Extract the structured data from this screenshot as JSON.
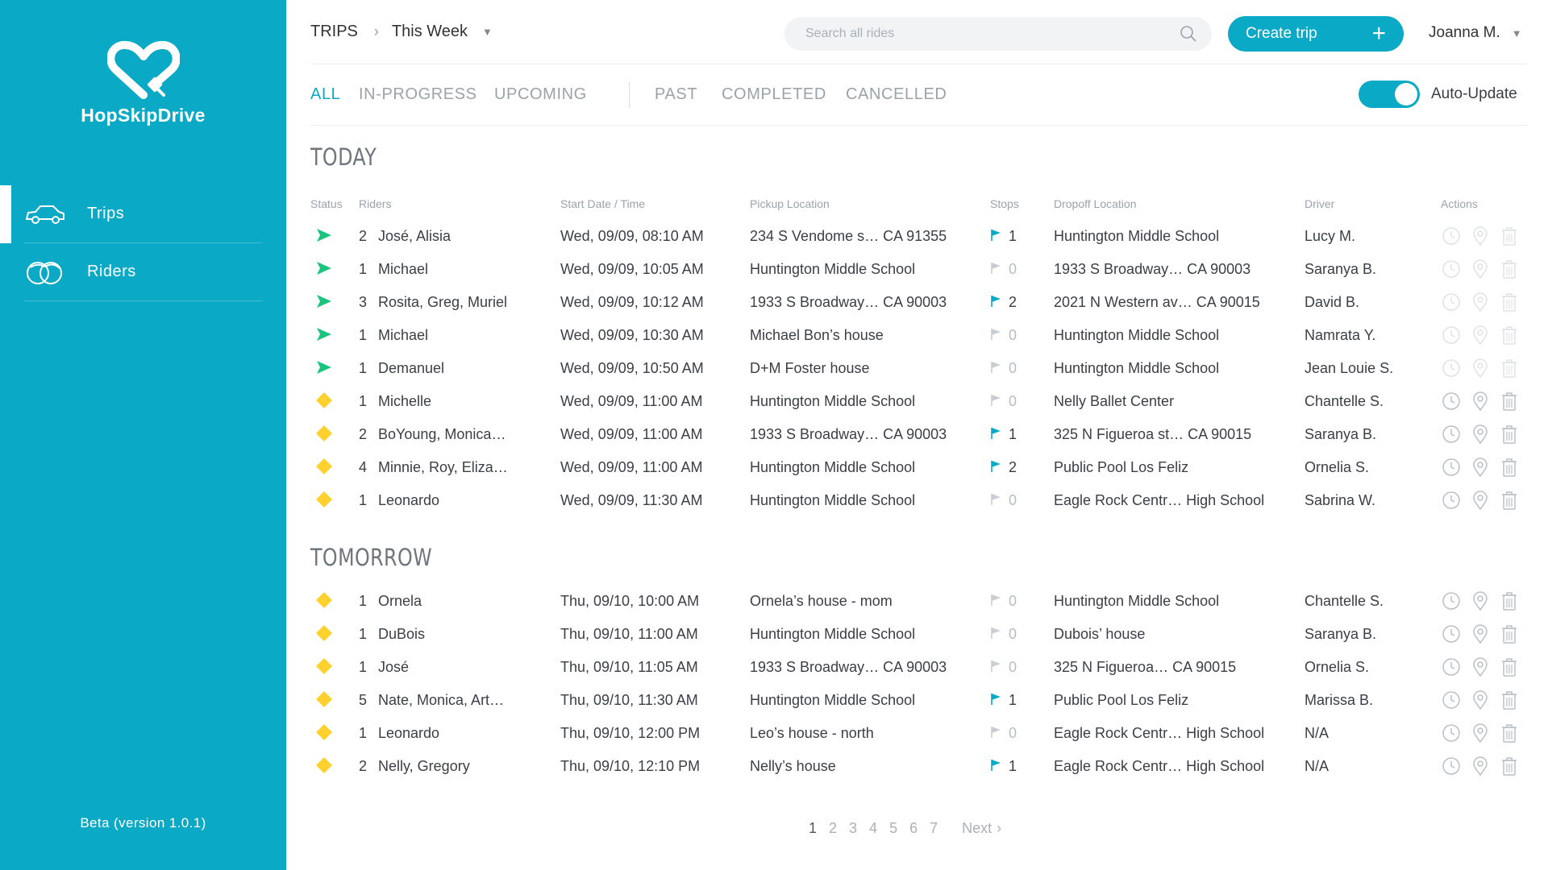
{
  "app": {
    "name": "HopSkipDrive",
    "beta": "Beta (version 1.0.1)",
    "brand_color": "#0aa9c6"
  },
  "sidebar": {
    "items": [
      {
        "label": "Trips",
        "icon": "car-icon",
        "active": true
      },
      {
        "label": "Riders",
        "icon": "riders-icon",
        "active": false
      }
    ]
  },
  "header": {
    "breadcrumb_root": "TRIPS",
    "breadcrumb_period": "This Week",
    "search_placeholder": "Search all rides",
    "create_label": "Create trip",
    "user_name": "Joanna M."
  },
  "filters": [
    "ALL",
    "IN-PROGRESS",
    "UPCOMING",
    "PAST",
    "COMPLETED",
    "CANCELLED"
  ],
  "active_filter": "ALL",
  "auto_update": {
    "label": "Auto-Update",
    "on": true
  },
  "columns": {
    "status": "Status",
    "riders": "Riders",
    "start": "Start Date / Time",
    "pickup": "Pickup Location",
    "stops": "Stops",
    "dropoff": "Dropoff Location",
    "driver": "Driver",
    "actions": "Actions"
  },
  "status_colors": {
    "in_progress": "#1bc47d",
    "upcoming": "#ffd12e"
  },
  "sections": [
    {
      "title": "TODAY",
      "rows": [
        {
          "status": "in-progress",
          "count": "2",
          "riders": "José, Alisia",
          "start": "Wed, 09/09, 08:10 AM",
          "pickup": "234 S Vendome s… CA 91355",
          "stops": "1",
          "dropoff": "Huntington Middle School",
          "driver": "Lucy M."
        },
        {
          "status": "in-progress",
          "count": "1",
          "riders": "Michael",
          "start": "Wed, 09/09, 10:05 AM",
          "pickup": "Huntington Middle School",
          "stops": "0",
          "dropoff": "1933 S Broadway… CA 90003",
          "driver": "Saranya B."
        },
        {
          "status": "in-progress",
          "count": "3",
          "riders": "Rosita, Greg, Muriel",
          "start": "Wed, 09/09, 10:12 AM",
          "pickup": "1933 S Broadway… CA 90003",
          "stops": "2",
          "dropoff": "2021 N Western av… CA 90015",
          "driver": "David B."
        },
        {
          "status": "in-progress",
          "count": "1",
          "riders": "Michael",
          "start": "Wed, 09/09, 10:30 AM",
          "pickup": "Michael Bon’s house",
          "stops": "0",
          "dropoff": "Huntington Middle School",
          "driver": "Namrata Y."
        },
        {
          "status": "in-progress",
          "count": "1",
          "riders": "Demanuel",
          "start": "Wed, 09/09, 10:50 AM",
          "pickup": "D+M Foster house",
          "stops": "0",
          "dropoff": "Huntington Middle School",
          "driver": "Jean Louie S."
        },
        {
          "status": "upcoming",
          "count": "1",
          "riders": "Michelle",
          "start": "Wed, 09/09, 11:00 AM",
          "pickup": "Huntington Middle School",
          "stops": "0",
          "dropoff": "Nelly Ballet Center",
          "driver": "Chantelle S."
        },
        {
          "status": "upcoming",
          "count": "2",
          "riders": "BoYoung, Monica…",
          "start": "Wed, 09/09, 11:00 AM",
          "pickup": "1933 S Broadway… CA 90003",
          "stops": "1",
          "dropoff": "325 N Figueroa st… CA 90015",
          "driver": "Saranya B."
        },
        {
          "status": "upcoming",
          "count": "4",
          "riders": "Minnie, Roy, Eliza…",
          "start": "Wed, 09/09, 11:00 AM",
          "pickup": "Huntington Middle School",
          "stops": "2",
          "dropoff": "Public Pool Los Feliz",
          "driver": "Ornelia S."
        },
        {
          "status": "upcoming",
          "count": "1",
          "riders": "Leonardo",
          "start": "Wed, 09/09, 11:30 AM",
          "pickup": "Huntington Middle School",
          "stops": "0",
          "dropoff": "Eagle Rock Centr… High School",
          "driver": "Sabrina W."
        }
      ]
    },
    {
      "title": "TOMORROW",
      "rows": [
        {
          "status": "upcoming",
          "count": "1",
          "riders": "Ornela",
          "start": "Thu, 09/10, 10:00 AM",
          "pickup": "Ornela’s house - mom",
          "stops": "0",
          "dropoff": "Huntington Middle School",
          "driver": "Chantelle S."
        },
        {
          "status": "upcoming",
          "count": "1",
          "riders": "DuBois",
          "start": "Thu, 09/10, 11:00 AM",
          "pickup": "Huntington Middle School",
          "stops": "0",
          "dropoff": "Dubois’ house",
          "driver": "Saranya B."
        },
        {
          "status": "upcoming",
          "count": "1",
          "riders": "José",
          "start": "Thu, 09/10, 11:05 AM",
          "pickup": "1933 S Broadway… CA 90003",
          "stops": "0",
          "dropoff": "325 N Figueroa… CA 90015",
          "driver": "Ornelia S."
        },
        {
          "status": "upcoming",
          "count": "5",
          "riders": "Nate, Monica, Art…",
          "start": "Thu, 09/10, 11:30 AM",
          "pickup": "Huntington Middle School",
          "stops": "1",
          "dropoff": "Public Pool Los Feliz",
          "driver": "Marissa B."
        },
        {
          "status": "upcoming",
          "count": "1",
          "riders": "Leonardo",
          "start": "Thu, 09/10, 12:00 PM",
          "pickup": "Leo’s house - north",
          "stops": "0",
          "dropoff": "Eagle Rock Centr… High School",
          "driver": "N/A"
        },
        {
          "status": "upcoming",
          "count": "2",
          "riders": "Nelly, Gregory",
          "start": "Thu, 09/10, 12:10 PM",
          "pickup": "Nelly’s house",
          "stops": "1",
          "dropoff": "Eagle Rock Centr… High School",
          "driver": "N/A"
        }
      ]
    }
  ],
  "pagination": {
    "pages": [
      "1",
      "2",
      "3",
      "4",
      "5",
      "6",
      "7"
    ],
    "current": "1",
    "next_label": "Next"
  }
}
